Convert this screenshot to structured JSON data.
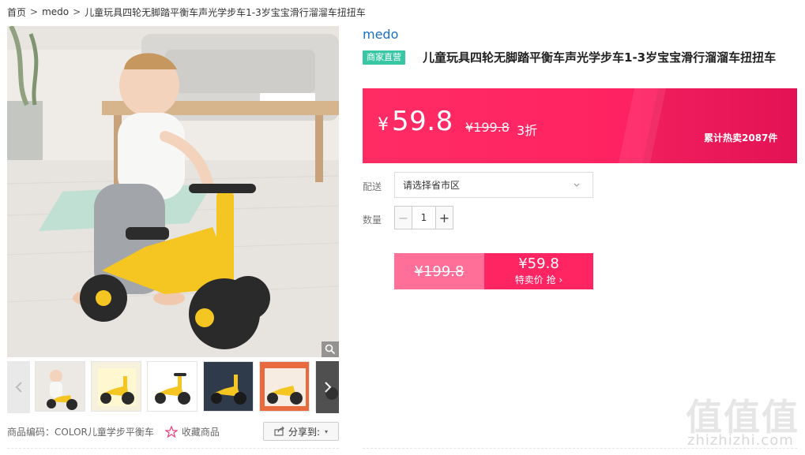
{
  "breadcrumb": [
    "首页",
    "medo",
    "儿童玩具四轮无脚踏平衡车声光学步车1-3岁宝宝滑行溜溜车扭扭车"
  ],
  "breadcrumb_separator": ">",
  "gallery": {
    "thumb_count": 6,
    "zoom_icon": "magnifier-icon",
    "prev_icon": "chevron-left-icon",
    "next_icon": "chevron-right-icon"
  },
  "meta": {
    "sku": "商品编码：COLOR儿童学步平衡车",
    "favorite_label": "收藏商品",
    "share_label": "分享到:",
    "share_caret": "▾"
  },
  "product": {
    "brand": "medo",
    "badge": "商家直营",
    "title": "儿童玩具四轮无脚踏平衡车声光学步车1-3岁宝宝滑行溜溜车扭扭车"
  },
  "price_band": {
    "currency": "¥",
    "price": "59.8",
    "original": "¥199.8",
    "discount": "3折",
    "sold": "累计热卖2087件",
    "colors": {
      "primary": "#ff2462",
      "light": "#ff6f98"
    }
  },
  "delivery": {
    "label": "配送",
    "placeholder": "请选择省市区"
  },
  "quantity": {
    "label": "数量",
    "value": "1",
    "minus": "−",
    "plus": "+"
  },
  "buy_button": {
    "original": "¥199.8",
    "price": "¥59.8",
    "text": "特卖价 抢 ›"
  },
  "watermark": {
    "logo": "值值值",
    "site": "zhizhizhi.com"
  }
}
